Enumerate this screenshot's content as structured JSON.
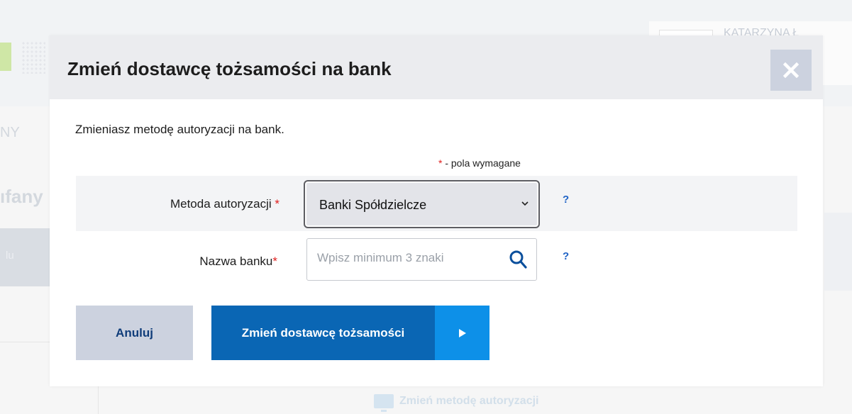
{
  "background": {
    "user_name": "KATARZYNA Ł",
    "tab_fragment": "NY",
    "heading_fragment": "ıfany",
    "sidebar_fragment": "lu",
    "bottom_link": "Zmień metodę autoryzacji"
  },
  "modal": {
    "title": "Zmień dostawcę tożsamości na bank",
    "close_icon": "close-icon",
    "description": "Zmieniasz metodę autoryzacji na bank.",
    "required_note": {
      "star": "*",
      "text": " - pola wymagane"
    },
    "fields": {
      "auth_method": {
        "label": "Metoda autoryzacji ",
        "required_star": "*",
        "selected_value": "Banki Spółdzielcze",
        "help": "?"
      },
      "bank_name": {
        "label": "Nazwa banku",
        "required_star": "*",
        "placeholder": "Wpisz minimum 3 znaki",
        "value": "",
        "help": "?"
      }
    },
    "buttons": {
      "cancel": "Anuluj",
      "submit": "Zmień dostawcę tożsamości"
    },
    "colors": {
      "primary": "#0a66b4",
      "primary_arrow": "#0d90e8",
      "secondary": "#ccd2df",
      "required": "#e0201f",
      "help": "#1f63c6"
    }
  }
}
